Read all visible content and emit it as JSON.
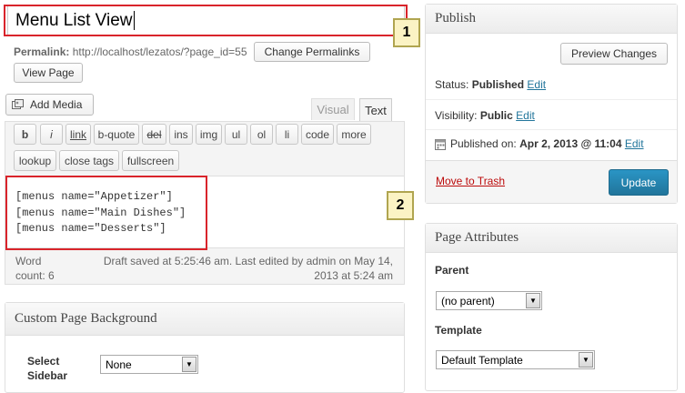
{
  "editor": {
    "title_value": "Menu List View",
    "permalink_label": "Permalink:",
    "permalink_url": "http://localhost/lezatos/?page_id=55",
    "change_permalinks": "Change Permalinks",
    "view_page": "View Page",
    "add_media": "Add Media",
    "tab_visual": "Visual",
    "tab_text": "Text",
    "quicktags_row1": [
      "b",
      "i",
      "link",
      "b-quote",
      "del",
      "ins",
      "img",
      "ul",
      "ol",
      "li",
      "code",
      "more"
    ],
    "quicktags_row2": [
      "lookup",
      "close tags",
      "fullscreen"
    ],
    "content_lines": [
      "[menus name=\"Appetizer\"]",
      "[menus name=\"Main Dishes\"]",
      "[menus name=\"Desserts\"]"
    ],
    "word_count_label": "Word count:",
    "word_count": "6",
    "draft_status": "Draft saved at 5:25:46 am. Last edited by admin on May 14, 2013 at 5:24 am"
  },
  "custom_background": {
    "title": "Custom Page Background",
    "select_sidebar_label": "Select Sidebar",
    "sidebar_value": "None"
  },
  "publish": {
    "title": "Publish",
    "preview_changes": "Preview Changes",
    "status_label": "Status:",
    "status_value": "Published",
    "visibility_label": "Visibility:",
    "visibility_value": "Public",
    "edit_label": "Edit",
    "published_on_label": "Published on:",
    "published_on_value": "Apr 2, 2013 @ 11:04",
    "move_to_trash": "Move to Trash",
    "update": "Update"
  },
  "page_attributes": {
    "title": "Page Attributes",
    "parent_label": "Parent",
    "parent_value": "(no parent)",
    "template_label": "Template",
    "template_value": "Default Template"
  },
  "callouts": [
    "1",
    "2"
  ],
  "colors": {
    "link": "#21759b",
    "trash": "#bc0b0b",
    "primary_button": "#2a95c5",
    "callout_border": "#d9242b"
  }
}
